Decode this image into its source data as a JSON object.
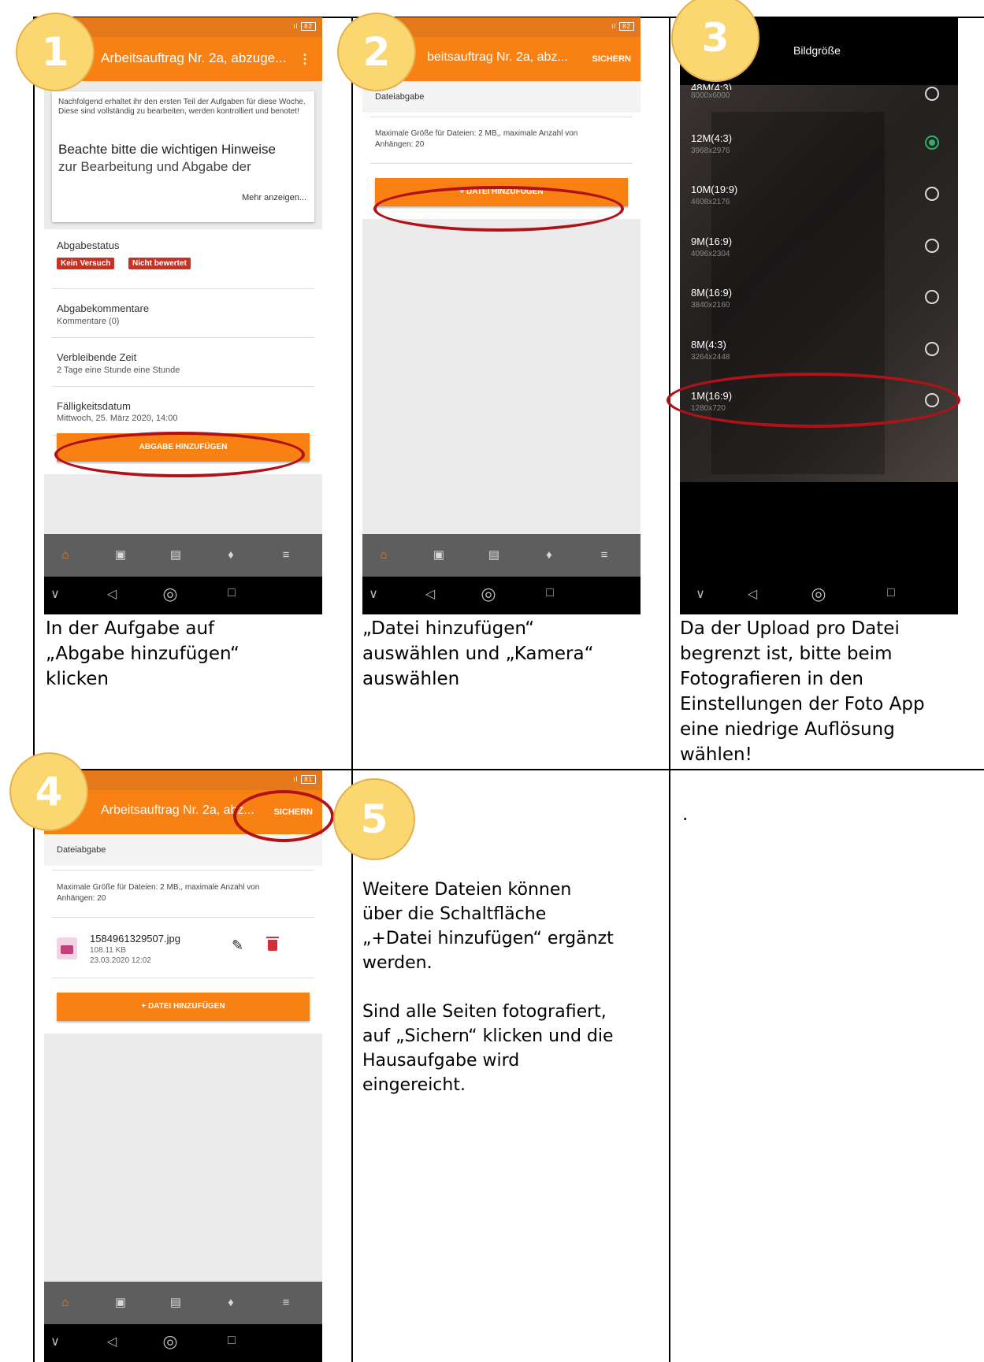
{
  "steps": {
    "one": {
      "number": "1",
      "caption_lines": [
        "In der Aufgabe auf",
        "„Abgabe hinzufügen“",
        "klicken"
      ]
    },
    "two": {
      "number": "2",
      "caption_lines": [
        "„Datei hinzufügen“",
        "auswählen und „Kamera“",
        "auswählen"
      ]
    },
    "three": {
      "number": "3",
      "caption_lines": [
        "Da der Upload pro Datei",
        "begrenzt ist, bitte beim",
        "Fotografieren in den",
        "Einstellungen der Foto App",
        "eine niedrige Auflösung",
        "wählen!"
      ]
    },
    "four": {
      "number": "4"
    },
    "five": {
      "number": "5",
      "caption_lines": [
        "Weitere Dateien können",
        "über die Schaltfläche",
        "„+Datei hinzufügen“ ergänzt",
        "werden.",
        "",
        "Sind alle Seiten fotografiert,",
        "auf „Sichern“ klicken und die",
        "Hausaufgabe wird",
        "eingereicht."
      ]
    },
    "six": {
      "text": "."
    }
  },
  "screen1": {
    "title": "Arbeitsauftrag Nr. 2a, abzuge...",
    "menu_icon": "more-vert-icon",
    "battery": "82",
    "intro": "Nachfolgend erhaltet ihr den ersten Teil der Aufgaben für diese Woche. Diese sind vollständig zu bearbeiten, werden kontrolliert und benotet!",
    "heading_line1": "Beachte bitte die wichtigen Hinweise",
    "heading_line2": "zur Bearbeitung und Abgabe der",
    "more": "Mehr anzeigen...",
    "status_label": "Abgabestatus",
    "badge1": "Kein Versuch",
    "badge2": "Nicht bewertet",
    "comments_label": "Abgabekommentare",
    "comments_value": "Kommentare (0)",
    "remaining_label": "Verbleibende Zeit",
    "remaining_value": "2 Tage eine Stunde eine Stunde",
    "due_label": "Fälligkeitsdatum",
    "due_value": "Mittwoch, 25. März 2020, 14:00",
    "button": "ABGABE HINZUFÜGEN"
  },
  "screen2": {
    "title": "beitsauftrag Nr. 2a, abz...",
    "save": "SICHERN",
    "battery": "82",
    "section": "Dateiabgabe",
    "info_line1": "Maximale Größe für Dateien: 2 MB,, maximale Anzahl von",
    "info_line2": "Anhängen: 20",
    "button": "+ DATEI HINZUFÜGEN"
  },
  "screen3": {
    "title": "Bildgröße",
    "options": [
      {
        "name": "48M(4:3)",
        "res": "8000x6000",
        "selected": false
      },
      {
        "name": "12M(4:3)",
        "res": "3968x2976",
        "selected": true
      },
      {
        "name": "10M(19:9)",
        "res": "4608x2176",
        "selected": false
      },
      {
        "name": "9M(16:9)",
        "res": "4096x2304",
        "selected": false
      },
      {
        "name": "8M(16:9)",
        "res": "3840x2160",
        "selected": false
      },
      {
        "name": "8M(4:3)",
        "res": "3264x2448",
        "selected": false
      },
      {
        "name": "1M(16:9)",
        "res": "1280x720",
        "selected": false
      }
    ]
  },
  "screen4": {
    "title": "Arbeitsauftrag Nr. 2a, abz...",
    "save": "SICHERN",
    "battery": "81",
    "section": "Dateiabgabe",
    "info_line1": "Maximale Größe für Dateien: 2 MB,, maximale Anzahl von",
    "info_line2": "Anhängen: 20",
    "file_name": "1584961329507.jpg",
    "file_size": "108.11 KB",
    "file_date": "23.03.2020 12:02",
    "button": "+ DATEI HINZUFÜGEN"
  },
  "tabs": [
    {
      "icon": "home-icon",
      "glyph": "⌂"
    },
    {
      "icon": "calendar-icon",
      "glyph": "▣"
    },
    {
      "icon": "messages-icon",
      "glyph": "▤"
    },
    {
      "icon": "notifications-icon",
      "glyph": "♦"
    },
    {
      "icon": "menu-icon",
      "glyph": "≡"
    }
  ],
  "nav": [
    {
      "icon": "chevron-down-icon",
      "glyph": "∨"
    },
    {
      "icon": "back-icon",
      "glyph": "◁"
    },
    {
      "icon": "home-nav-icon",
      "glyph": "◎"
    },
    {
      "icon": "recents-icon",
      "glyph": "□"
    }
  ],
  "colors": {
    "orange": "#f98012",
    "badge_red": "#ca3120",
    "highlight_red": "#b01218",
    "number_yellow": "#fbd772",
    "radio_green": "#2bb267"
  }
}
